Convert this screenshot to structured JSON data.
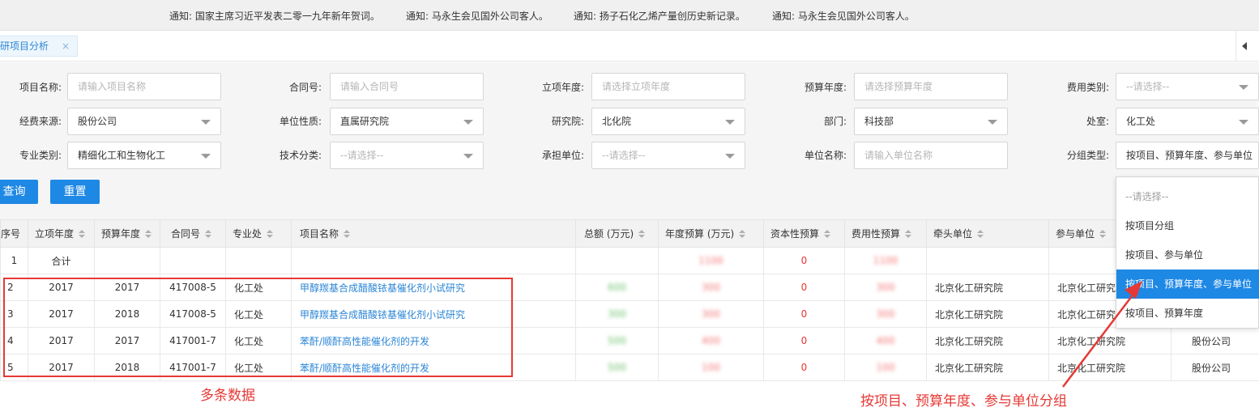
{
  "ticker": [
    "通知: 国家主席习近平发表二零一九年新年贺词。",
    "通知: 马永生会见国外公司客人。",
    "通知: 扬子石化乙烯产量创历史新记录。",
    "通知: 马永生会见国外公司客人。"
  ],
  "tab": {
    "label": "科研项目分析",
    "close": "×"
  },
  "filters": {
    "project_name": {
      "label": "项目名称:",
      "placeholder": "请输入项目名称"
    },
    "contract_no": {
      "label": "合同号:",
      "placeholder": "请输入合同号"
    },
    "start_year": {
      "label": "立项年度:",
      "placeholder": "请选择立项年度"
    },
    "budget_year": {
      "label": "预算年度:",
      "placeholder": "请选择预算年度"
    },
    "cost_type": {
      "label": "费用类别:",
      "placeholder": "--请选择--"
    },
    "fund_source": {
      "label": "经费来源:",
      "value": "股份公司"
    },
    "unit_nature": {
      "label": "单位性质:",
      "value": "直属研究院"
    },
    "institute": {
      "label": "研究院:",
      "value": "北化院"
    },
    "department": {
      "label": "部门:",
      "value": "科技部"
    },
    "office": {
      "label": "处室:",
      "value": "化工处"
    },
    "specialty": {
      "label": "专业类别:",
      "value": "精细化工和生物化工"
    },
    "tech_class": {
      "label": "技术分类:",
      "placeholder": "--请选择--"
    },
    "undertaker": {
      "label": "承担单位:",
      "placeholder": "--请选择--"
    },
    "unit_name": {
      "label": "单位名称:",
      "placeholder": "请输入单位名称"
    },
    "group_type": {
      "label": "分组类型:",
      "value": "按项目、预算年度、参与单位"
    }
  },
  "buttons": {
    "query": "查询",
    "reset": "重置"
  },
  "table": {
    "headers": [
      "序号",
      "立项年度",
      "预算年度",
      "合同号",
      "专业处",
      "项目名称",
      "总额 (万元)",
      "年度预算 (万元)",
      "资本性预算",
      "费用性预算",
      "牵头单位",
      "参与单位",
      ""
    ],
    "total_row": {
      "seq": "1",
      "label": "合计",
      "annual": "1100",
      "capital": "0",
      "expense": "1100"
    },
    "rows": [
      {
        "seq": "2",
        "start_year": "2017",
        "budget_year": "2017",
        "contract": "417008-5",
        "office": "化工处",
        "name": "甲醇羰基合成醋酸铱基催化剂小试研究",
        "total": "600",
        "annual": "300",
        "capital": "0",
        "expense": "300",
        "lead": "北京化工研究院",
        "partner": "北京化工研究院",
        "extra": ""
      },
      {
        "seq": "3",
        "start_year": "2017",
        "budget_year": "2018",
        "contract": "417008-5",
        "office": "化工处",
        "name": "甲醇羰基合成醋酸铱基催化剂小试研究",
        "total": "300",
        "annual": "300",
        "capital": "0",
        "expense": "300",
        "lead": "北京化工研究院",
        "partner": "北京化工研究院",
        "extra": ""
      },
      {
        "seq": "4",
        "start_year": "2017",
        "budget_year": "2017",
        "contract": "417001-7",
        "office": "化工处",
        "name": "苯酐/顺酐高性能催化剂的开发",
        "total": "500",
        "annual": "400",
        "capital": "0",
        "expense": "400",
        "lead": "北京化工研究院",
        "partner": "北京化工研究院",
        "extra": "股份公司"
      },
      {
        "seq": "5",
        "start_year": "2017",
        "budget_year": "2018",
        "contract": "417001-7",
        "office": "化工处",
        "name": "苯酐/顺酐高性能催化剂的开发",
        "total": "500",
        "annual": "100",
        "capital": "0",
        "expense": "100",
        "lead": "北京化工研究院",
        "partner": "北京化工研究院",
        "extra": "股份公司"
      }
    ]
  },
  "dropdown": {
    "options": [
      "--请选择--",
      "按项目分组",
      "按项目、参与单位",
      "按项目、预算年度、参与单位",
      "按项目、预算年度"
    ],
    "selected_index": 3
  },
  "annotations": {
    "left_note": "多条数据",
    "right_note": "按项目、预算年度、参与单位分组",
    "color": "#e53935"
  },
  "colors": {
    "accent": "#1e88e5",
    "link": "#2b86d6"
  }
}
